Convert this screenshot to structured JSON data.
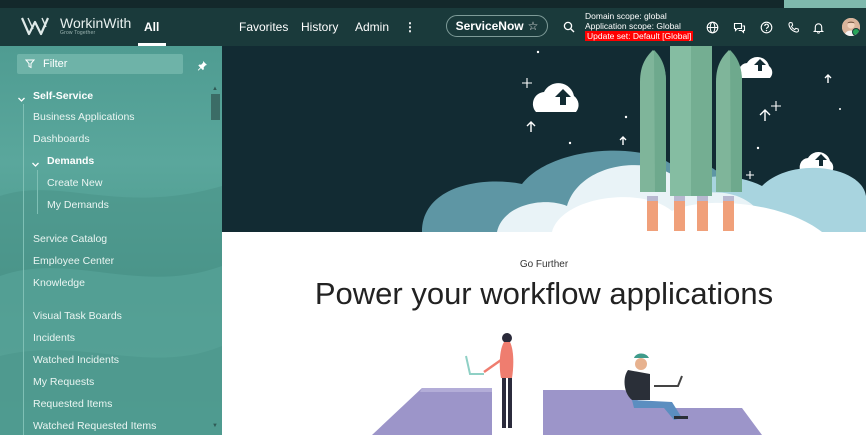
{
  "header": {
    "logo_name": "WorkinWith",
    "logo_tagline": "Grow Together",
    "tab_all": "All",
    "nav_items": [
      "Favorites",
      "History",
      "Admin"
    ],
    "more_glyph": "⋮",
    "app_pill_label": "ServiceNow",
    "app_pill_icon": "star-outline-icon",
    "scope": {
      "domain": "Domain scope: global",
      "application": "Application scope: Global",
      "update_set": "Update set: Default [Global]"
    },
    "icons": [
      "search-icon",
      "globe-icon",
      "chat-icon",
      "help-icon",
      "phone-icon",
      "bell-icon",
      "avatar"
    ],
    "colors": {
      "bar": "#1a3a3b",
      "update_set_bg": "#ff0000"
    }
  },
  "sidebar": {
    "filter_placeholder": "Filter",
    "sections": {
      "self_service": "Self-Service",
      "items_top": [
        "Business Applications",
        "Dashboards"
      ],
      "demands": "Demands",
      "demands_children": [
        "Create New",
        "My Demands"
      ],
      "items_bottom": [
        "Service Catalog",
        "Employee Center",
        "Knowledge",
        "Visual Task Boards",
        "Incidents",
        "Watched Incidents",
        "My Requests",
        "Requested Items",
        "Watched Requested Items"
      ]
    },
    "colors": {
      "bg": "#4f9c92"
    }
  },
  "main": {
    "eyebrow": "Go Further",
    "headline": "Power your workflow applications"
  }
}
